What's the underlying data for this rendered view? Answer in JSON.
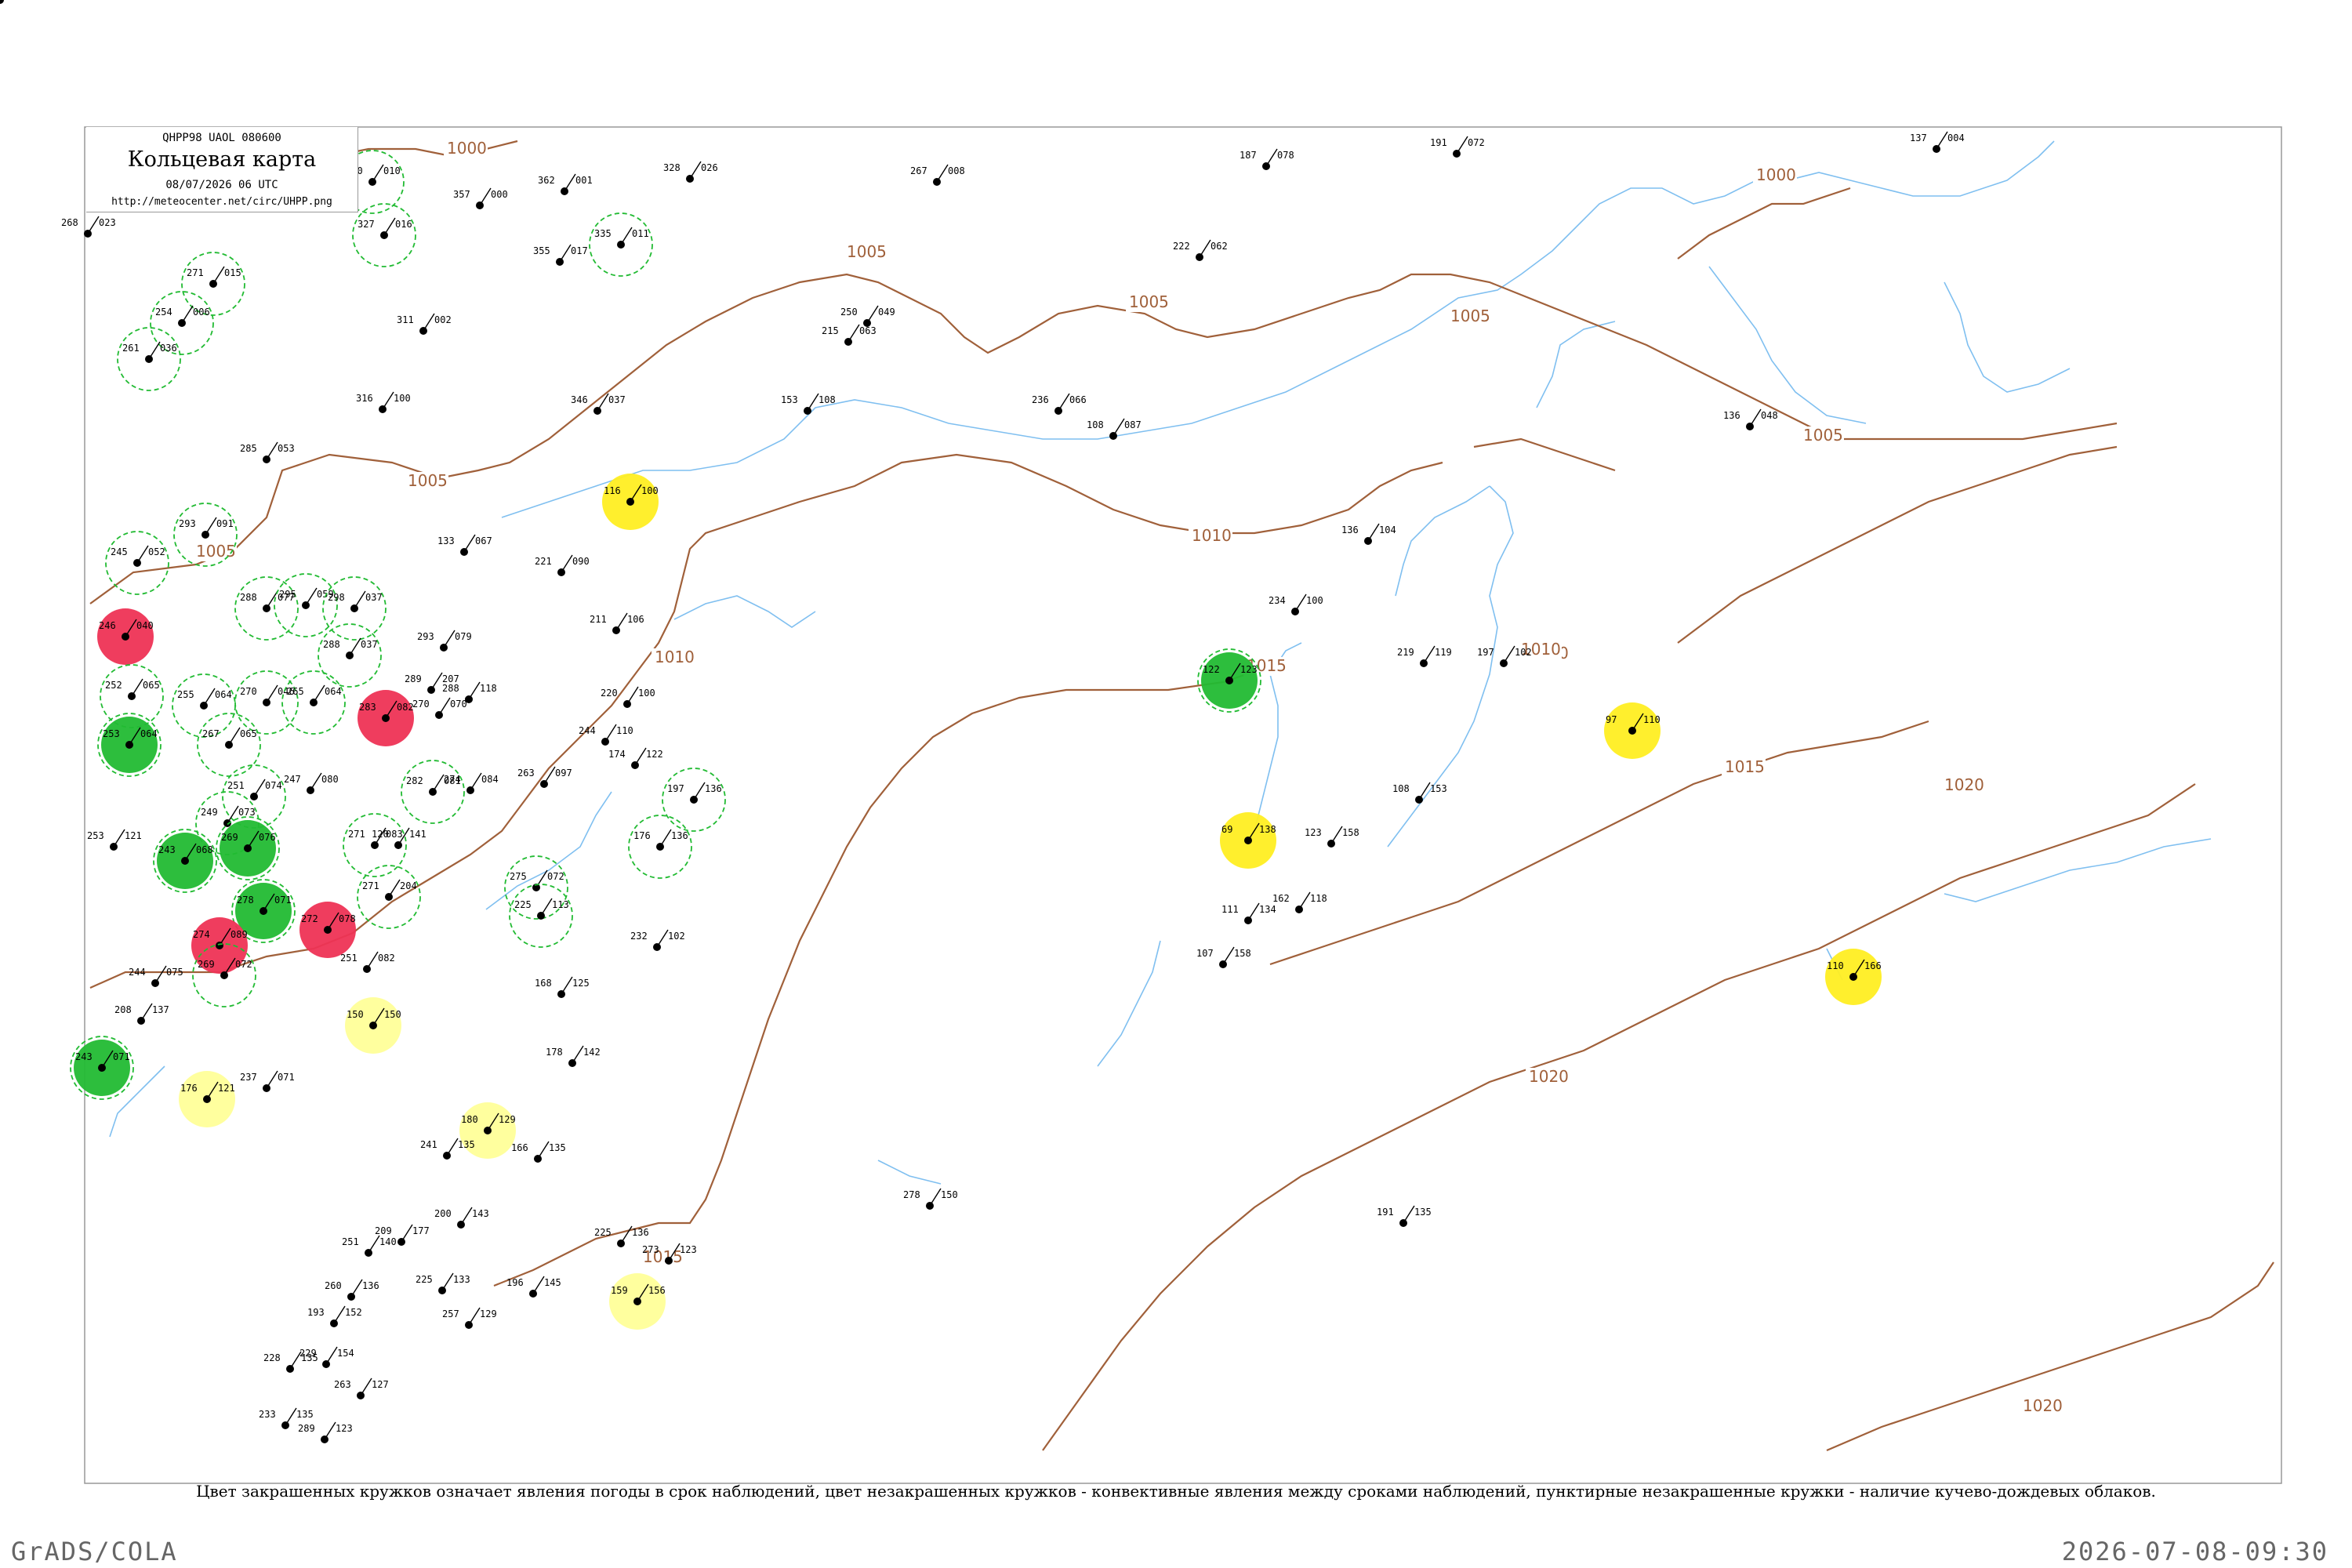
{
  "header": {
    "code": "QHPP98  UAOL  080600",
    "title": "Кольцевая карта",
    "date": "08/07/2026 06 UTC",
    "url": "http://meteocenter.net/circ/UHPP.png"
  },
  "isobars": [
    {
      "label": "1000"
    },
    {
      "label": "1000"
    },
    {
      "label": "1005"
    },
    {
      "label": "1005"
    },
    {
      "label": "1005"
    },
    {
      "label": "1005"
    },
    {
      "label": "1005"
    },
    {
      "label": "1005"
    },
    {
      "label": "1010"
    },
    {
      "label": "1010"
    },
    {
      "label": "1010"
    },
    {
      "label": "1010"
    },
    {
      "label": "1015"
    },
    {
      "label": "1015"
    },
    {
      "label": "1015"
    },
    {
      "label": "1020"
    },
    {
      "label": "1020"
    },
    {
      "label": "1020"
    }
  ],
  "colors": {
    "green": "#22bb33",
    "red": "#ee3355",
    "yellow": "#ffee22",
    "pale_yellow": "#ffff99",
    "isobar": "#a0603a",
    "coast": "#7fbff0",
    "frame": "#999999"
  },
  "stations": [
    {
      "code": "320 010",
      "legend": "dashed"
    },
    {
      "code": "327 016",
      "legend": "dashed"
    },
    {
      "code": "357 000",
      "legend": "none"
    },
    {
      "code": "362 001",
      "legend": "none"
    },
    {
      "code": "335 011",
      "legend": "dashed"
    },
    {
      "code": "328 026",
      "legend": "none"
    },
    {
      "code": "267 008",
      "legend": "none"
    },
    {
      "code": "187 078",
      "legend": "none"
    },
    {
      "code": "191 072",
      "legend": "none"
    },
    {
      "code": "137 004",
      "legend": "none"
    },
    {
      "code": "268 023",
      "legend": "none"
    },
    {
      "code": "271 015",
      "legend": "dashed"
    },
    {
      "code": "254 006",
      "legend": "dashed"
    },
    {
      "code": "261 036",
      "legend": "dashed"
    },
    {
      "code": "355 017",
      "legend": "none"
    },
    {
      "code": "222 062",
      "legend": "none"
    },
    {
      "code": "250 049",
      "legend": "none"
    },
    {
      "code": "215 063",
      "legend": "none"
    },
    {
      "code": "311 002",
      "legend": "none"
    },
    {
      "code": "316 100",
      "legend": "none"
    },
    {
      "code": "346 037",
      "legend": "none"
    },
    {
      "code": "153 108",
      "legend": "none"
    },
    {
      "code": "236 066",
      "legend": "none"
    },
    {
      "code": "108 087",
      "legend": "none"
    },
    {
      "code": "136 048",
      "legend": "none"
    },
    {
      "code": "285 053",
      "legend": "none"
    },
    {
      "code": "116 100",
      "legend": "yellow"
    },
    {
      "code": "293 091",
      "legend": "dashed"
    },
    {
      "code": "245 052",
      "legend": "dashed"
    },
    {
      "code": "133 067",
      "legend": "none"
    },
    {
      "code": "221 090",
      "legend": "none"
    },
    {
      "code": "288 077",
      "legend": "dashed"
    },
    {
      "code": "295 059",
      "legend": "dashed"
    },
    {
      "code": "298 037",
      "legend": "dashed"
    },
    {
      "code": "288 037",
      "legend": "dashed"
    },
    {
      "code": "293 079",
      "legend": "none"
    },
    {
      "code": "211 106",
      "legend": "none"
    },
    {
      "code": "246 040",
      "legend": "red"
    },
    {
      "code": "252 065",
      "legend": "dashed"
    },
    {
      "code": "255 064",
      "legend": "dashed"
    },
    {
      "code": "270 046",
      "legend": "dashed"
    },
    {
      "code": "265 064",
      "legend": "dashed"
    },
    {
      "code": "283 082",
      "legend": "red"
    },
    {
      "code": "289 207",
      "legend": "none"
    },
    {
      "code": "270 070",
      "legend": "none"
    },
    {
      "code": "288 118",
      "legend": "none"
    },
    {
      "code": "220 100",
      "legend": "none"
    },
    {
      "code": "244 110",
      "legend": "none"
    },
    {
      "code": "174 122",
      "legend": "none"
    },
    {
      "code": "197 136",
      "legend": "dashed"
    },
    {
      "code": "253 064",
      "legend": "green"
    },
    {
      "code": "267 065",
      "legend": "dashed"
    },
    {
      "code": "247 080",
      "legend": "none"
    },
    {
      "code": "282 081",
      "legend": "dashed"
    },
    {
      "code": "274 084",
      "legend": "none"
    },
    {
      "code": "263 097",
      "legend": "none"
    },
    {
      "code": "251 074",
      "legend": "dashed"
    },
    {
      "code": "249 073",
      "legend": "dashed"
    },
    {
      "code": "271 083",
      "legend": "dashed"
    },
    {
      "code": "176 136",
      "legend": "dashed"
    },
    {
      "code": "120 141",
      "legend": "none"
    },
    {
      "code": "271 204",
      "legend": "dashed"
    },
    {
      "code": "275 072",
      "legend": "dashed"
    },
    {
      "code": "225 113",
      "legend": "dashed"
    },
    {
      "code": "253 121",
      "legend": "none"
    },
    {
      "code": "243 068",
      "legend": "green"
    },
    {
      "code": "269 076",
      "legend": "green"
    },
    {
      "code": "278 071",
      "legend": "green"
    },
    {
      "code": "272 078",
      "legend": "red"
    },
    {
      "code": "274 089",
      "legend": "red"
    },
    {
      "code": "269 072",
      "legend": "dashed"
    },
    {
      "code": "244 075",
      "legend": "none"
    },
    {
      "code": "251 082",
      "legend": "none"
    },
    {
      "code": "232 102",
      "legend": "none"
    },
    {
      "code": "150 150",
      "legend": "pale_yellow"
    },
    {
      "code": "168 125",
      "legend": "none"
    },
    {
      "code": "178 142",
      "legend": "none"
    },
    {
      "code": "208 137",
      "legend": "none"
    },
    {
      "code": "243 071",
      "legend": "green"
    },
    {
      "code": "237 071",
      "legend": "none"
    },
    {
      "code": "176 121",
      "legend": "pale_yellow"
    },
    {
      "code": "180 129",
      "legend": "pale_yellow"
    },
    {
      "code": "241 135",
      "legend": "none"
    },
    {
      "code": "166 135",
      "legend": "none"
    },
    {
      "code": "200 143",
      "legend": "none"
    },
    {
      "code": "225 136",
      "legend": "none"
    },
    {
      "code": "273 123",
      "legend": "none"
    },
    {
      "code": "196 145",
      "legend": "none"
    },
    {
      "code": "159 156",
      "legend": "pale_yellow"
    },
    {
      "code": "251 140",
      "legend": "none"
    },
    {
      "code": "209 177",
      "legend": "none"
    },
    {
      "code": "225 133",
      "legend": "none"
    },
    {
      "code": "260 136",
      "legend": "none"
    },
    {
      "code": "193 152",
      "legend": "none"
    },
    {
      "code": "257 129",
      "legend": "none"
    },
    {
      "code": "228 135",
      "legend": "none"
    },
    {
      "code": "229 154",
      "legend": "none"
    },
    {
      "code": "263 127",
      "legend": "none"
    },
    {
      "code": "233 135",
      "legend": "none"
    },
    {
      "code": "289 123",
      "legend": "none"
    },
    {
      "code": "278 150",
      "legend": "none"
    },
    {
      "code": "191 135",
      "legend": "none"
    },
    {
      "code": "219 119",
      "legend": "none"
    },
    {
      "code": "197 102",
      "legend": "none"
    },
    {
      "code": "136 104",
      "legend": "none"
    },
    {
      "code": "234 100",
      "legend": "none"
    },
    {
      "code": "122 123",
      "legend": "green"
    },
    {
      "code": "108 153",
      "legend": "none"
    },
    {
      "code": "97 110",
      "legend": "yellow"
    },
    {
      "code": "69 138",
      "legend": "yellow"
    },
    {
      "code": "123 158",
      "legend": "none"
    },
    {
      "code": "162 118",
      "legend": "none"
    },
    {
      "code": "111 134",
      "legend": "none"
    },
    {
      "code": "107 158",
      "legend": "none"
    },
    {
      "code": "110 166",
      "legend": "yellow"
    },
    {
      "code": "247 107",
      "legend": "none"
    }
  ],
  "caption": "Цвет закрашенных кружков означает явления погоды в срок наблюдений, цвет незакрашенных кружков - конвективные явления между сроками наблюдений, пунктирные незакрашенные кружки - наличие кучево-дождевых облаков.",
  "footer": {
    "left": "GrADS/COLA",
    "right": "2026-07-08-09:30"
  }
}
